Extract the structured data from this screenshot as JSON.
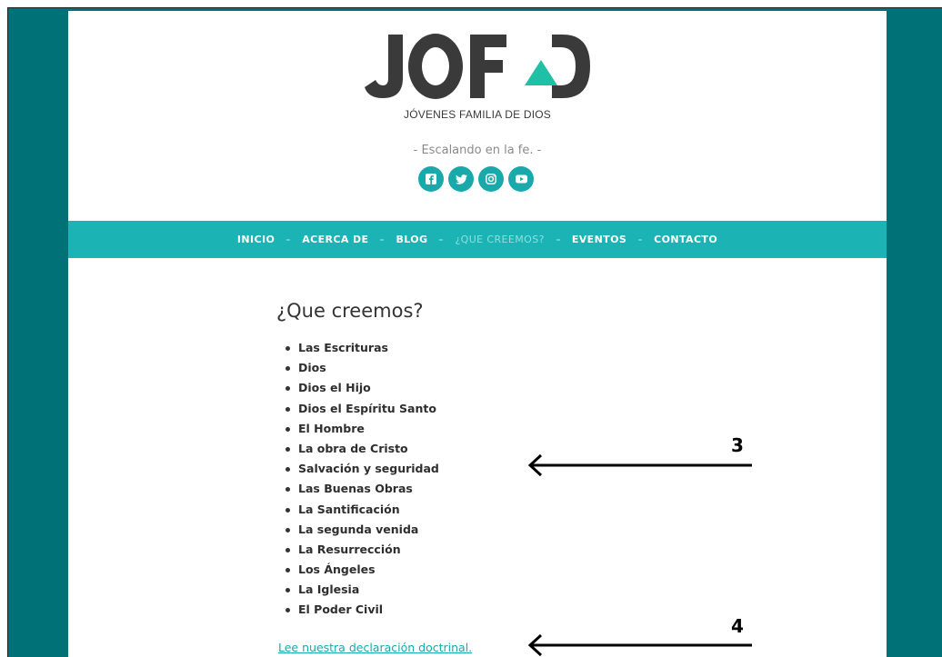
{
  "header": {
    "logo_text": "JOFAD",
    "logo_subtitle": "JÓVENES FAMILIA DE DIOS",
    "slogan": "- Escalando en la fe. -",
    "social": [
      "facebook-icon",
      "twitter-icon",
      "instagram-icon",
      "youtube-icon"
    ],
    "colors": {
      "accent": "#1bb3b4",
      "logo_dark": "#3a3a3a",
      "logo_triangle": "#20c0a6",
      "side_bg": "#007176"
    }
  },
  "nav": {
    "items": [
      {
        "label": "INICIO"
      },
      {
        "label": "ACERCA DE"
      },
      {
        "label": "BLOG"
      },
      {
        "label": "¿QUE CREEMOS?"
      },
      {
        "label": "EVENTOS"
      },
      {
        "label": "CONTACTO"
      }
    ],
    "active_index": 3
  },
  "main": {
    "title": "¿Que creemos?",
    "doctrines": [
      "Las Escrituras",
      "Dios",
      "Dios el Hijo",
      "Dios el Espíritu Santo",
      "El Hombre",
      "La obra de Cristo",
      "Salvación y seguridad",
      "Las Buenas Obras",
      "La Santificación",
      "La segunda venida",
      "La Resurrección",
      "Los Ángeles",
      "La Iglesia",
      "El Poder Civil"
    ],
    "declaration_link": "Lee nuestra declaración doctrinal."
  },
  "annotations": {
    "marker_3": "3",
    "marker_4": "4"
  }
}
